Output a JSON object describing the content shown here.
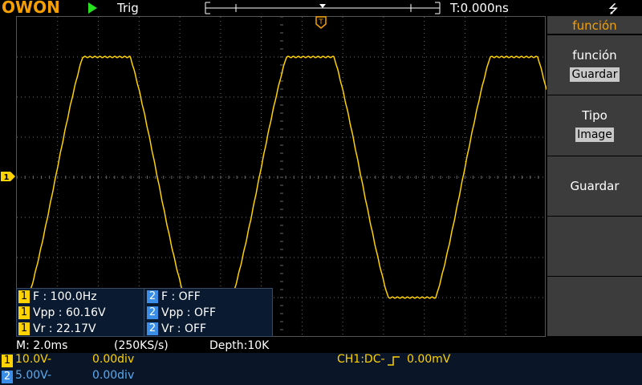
{
  "topbar": {
    "logo": "OWON",
    "trig_label": "Trig",
    "time_offset": "T:0.000ns"
  },
  "colors": {
    "ch1": "#ffd200",
    "ch2": "#3a8ee8",
    "accent": "#f5a000",
    "run": "#27e020",
    "grid": "#6a6a6a"
  },
  "icons": {
    "run": "play-triangle-icon",
    "usb": "usb-icon",
    "trigger_marker": "trigger-position-icon",
    "ch1_marker": "ch1-level-icon"
  },
  "measurements": {
    "rows": [
      {
        "ch1_badge": "1",
        "ch1_text": "F : 100.0Hz",
        "ch2_badge": "2",
        "ch2_text": "F : OFF"
      },
      {
        "ch1_badge": "1",
        "ch1_text": "Vpp : 60.16V",
        "ch2_badge": "2",
        "ch2_text": "Vpp : OFF"
      },
      {
        "ch1_badge": "1",
        "ch1_text": "Vr : 22.17V",
        "ch2_badge": "2",
        "ch2_text": "Vr : OFF"
      }
    ]
  },
  "menu": {
    "title": "función",
    "items": [
      {
        "label": "función",
        "value": "Guardar"
      },
      {
        "label": "Tipo",
        "value": "Image"
      },
      {
        "label": "Guardar",
        "value": ""
      },
      {
        "label": "",
        "value": ""
      },
      {
        "label": "",
        "value": ""
      }
    ]
  },
  "status": {
    "timebase": "M: 2.0ms",
    "sample_rate": "(250KS/s)",
    "depth": "Depth:10K",
    "ch1_badge": "1",
    "ch1_scale": "10.0V",
    "ch1_coupling_symbol": "-",
    "ch1_offset": "0.00div",
    "ch2_badge": "2",
    "ch2_scale": "5.00V",
    "ch2_coupling_symbol": "-",
    "ch2_offset": "0.00div",
    "trigger_info": "CH1:DC- ",
    "trigger_level": "0.00mV"
  },
  "waveform": {
    "channel": "CH1",
    "shape": "clipped-sine",
    "frequency_hz": 100,
    "timebase_s_per_div": 0.002,
    "volts_per_div": 10,
    "grid_h_divs": 13,
    "grid_v_divs": 8,
    "peak_divs": 3.0,
    "clip_divs": 3.0,
    "phase_start_div": -0.3
  }
}
